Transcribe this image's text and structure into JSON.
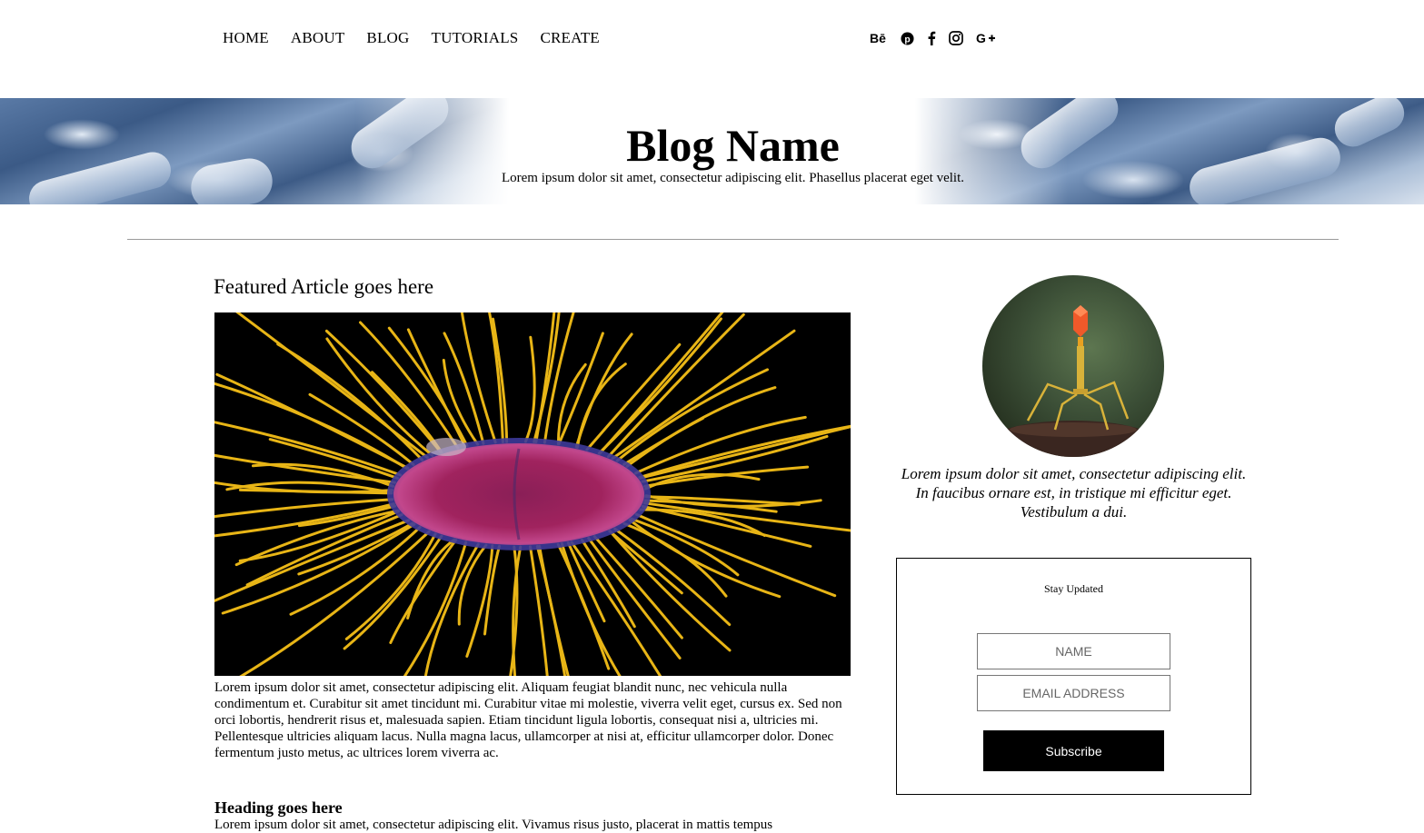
{
  "nav": {
    "links": [
      "HOME",
      "ABOUT",
      "BLOG",
      "TUTORIALS",
      "CREATE"
    ],
    "social_icons": [
      "behance-icon",
      "pinterest-icon",
      "facebook-icon",
      "instagram-icon",
      "google-plus-icon"
    ]
  },
  "hero": {
    "title": "Blog Name",
    "subtitle": "Lorem ipsum dolor sit amet, consectetur adipiscing elit. Phasellus placerat eget velit."
  },
  "featured": {
    "title": "Featured Article goes here",
    "body": "Lorem ipsum dolor sit amet, consectetur adipiscing elit. Aliquam feugiat blandit nunc, nec vehicula nulla condimentum et. Curabitur sit amet tincidunt mi. Curabitur vitae mi molestie, viverra velit eget, cursus ex. Sed non orci lobortis, hendrerit risus et, malesuada sapien. Etiam tincidunt ligula lobortis, consequat nisi a, ultricies mi. Pellentesque ultricies aliquam lacus. Nulla magna lacus, ullamcorper at nisi at, efficitur ullamcorper dolor. Donec fermentum justo metus, ac ultrices lorem viverra ac."
  },
  "section2": {
    "heading": "Heading goes here",
    "body": "Lorem ipsum dolor sit amet, consectetur adipiscing elit. Vivamus risus justo, placerat in mattis tempus"
  },
  "sidebar": {
    "bio": "Lorem ipsum dolor sit amet, consectetur adipiscing elit. In faucibus ornare est, in tristique mi efficitur eget. Vestibulum a dui.",
    "subscribe": {
      "title": "Stay Updated",
      "name_placeholder": "NAME",
      "email_placeholder": "EMAIL ADDRESS",
      "button_label": "Subscribe"
    }
  },
  "colors": {
    "accent": "#000000",
    "divider": "#9a9a9a",
    "flagella": "#e8b516",
    "bacterium": "#a0235e"
  }
}
